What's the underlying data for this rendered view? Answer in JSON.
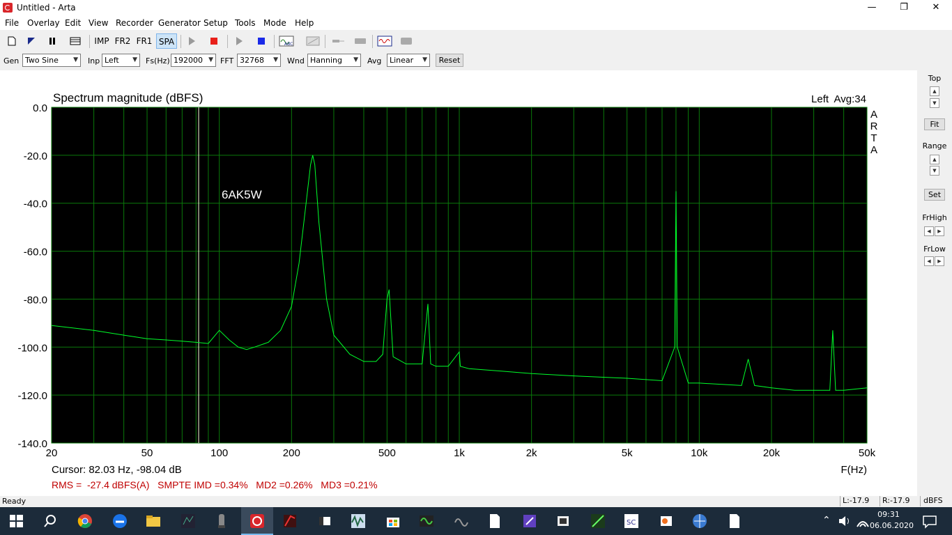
{
  "window": {
    "title": "Untitled - Arta"
  },
  "menu": [
    "File",
    "Overlay",
    "Edit",
    "View",
    "Recorder",
    "Generator",
    "Setup",
    "Tools",
    "Mode",
    "Help"
  ],
  "toolbar": {
    "imp": "IMP",
    "fr2": "FR2",
    "fr1": "FR1",
    "spa": "SPA"
  },
  "controls": {
    "gen_label": "Gen",
    "gen_value": "Two Sine",
    "inp_label": "Inp",
    "inp_value": "Left",
    "fs_label": "Fs(Hz)",
    "fs_value": "192000",
    "fft_label": "FFT",
    "fft_value": "32768",
    "wnd_label": "Wnd",
    "wnd_value": "Hanning",
    "avg_label": "Avg",
    "avg_value": "Linear",
    "reset": "Reset"
  },
  "side_panel": {
    "top": "Top",
    "fit": "Fit",
    "range": "Range",
    "set": "Set",
    "frhigh": "FrHigh",
    "frlow": "FrLow"
  },
  "graph": {
    "info": "Left  Avg:34",
    "arta_letters": [
      "A",
      "R",
      "T",
      "A"
    ],
    "annotation": "6AK5W",
    "cursor": "Cursor: 82.03 Hz, -98.04 dB",
    "measurements": "RMS =  -27.4 dBFS(A)   SMPTE IMD =0.34%   MD2 =0.26%   MD3 =0.21%",
    "cursor_freq": 82.03
  },
  "status": {
    "ready": "Ready",
    "left": "L:-17.9",
    "right": "R:-17.9",
    "unit": "dBFS"
  },
  "taskbar": {
    "time": "09:31",
    "date": "06.06.2020"
  },
  "colors": {
    "trace": "#00ff2a",
    "grid": "#0a7a0a",
    "bg": "#000000",
    "cursor": "#ffffe0",
    "measure": "#c00000"
  },
  "chart_data": {
    "type": "line",
    "title": "Spectrum magnitude (dBFS)",
    "xlabel": "F(Hz)",
    "ylabel": "",
    "x_scale": "log",
    "xlim": [
      20,
      50000
    ],
    "ylim": [
      -140,
      0
    ],
    "x_ticks": [
      20,
      50,
      100,
      200,
      500,
      1000,
      2000,
      5000,
      10000,
      20000,
      50000
    ],
    "x_tick_labels": [
      "20",
      "50",
      "100",
      "200",
      "500",
      "1k",
      "2k",
      "5k",
      "10k",
      "20k",
      "50k"
    ],
    "y_ticks": [
      0,
      -20,
      -40,
      -60,
      -80,
      -100,
      -120,
      -140
    ],
    "y_tick_labels": [
      "0.0",
      "-20.0",
      "-40.0",
      "-60.0",
      "-80.0",
      "-100.0",
      "-120.0",
      "-140.0"
    ],
    "grid": true,
    "series": [
      {
        "x": [
          20,
          30,
          40,
          50,
          60,
          70,
          80,
          90,
          100,
          110,
          120,
          130,
          140,
          160,
          180,
          200,
          215,
          230,
          240,
          245,
          250,
          260,
          280,
          300,
          350,
          400,
          450,
          480,
          500,
          510,
          530,
          600,
          700,
          740,
          760,
          800,
          900,
          1000,
          1010,
          1100,
          1500,
          2000,
          3000,
          5000,
          7000,
          7900,
          8000,
          8100,
          9000,
          10000,
          15000,
          16000,
          17000,
          20000,
          25000,
          35000,
          36000,
          37000,
          40000,
          50000
        ],
        "y": [
          -91,
          -93,
          -95,
          -96.5,
          -97,
          -97.5,
          -98,
          -98.5,
          -93,
          -97,
          -100,
          -101,
          -100,
          -98,
          -93,
          -83,
          -65,
          -40,
          -24,
          -20,
          -24,
          -48,
          -80,
          -95,
          -103,
          -106,
          -106,
          -103,
          -80,
          -76,
          -104,
          -107,
          -107,
          -82,
          -107,
          -108,
          -108,
          -102,
          -108,
          -109,
          -110,
          -111,
          -112,
          -113,
          -114,
          -100,
          -35,
          -100,
          -115,
          -115,
          -116,
          -105,
          -116,
          -117,
          -118,
          -118,
          -93,
          -118,
          -118,
          -117
        ]
      }
    ]
  }
}
